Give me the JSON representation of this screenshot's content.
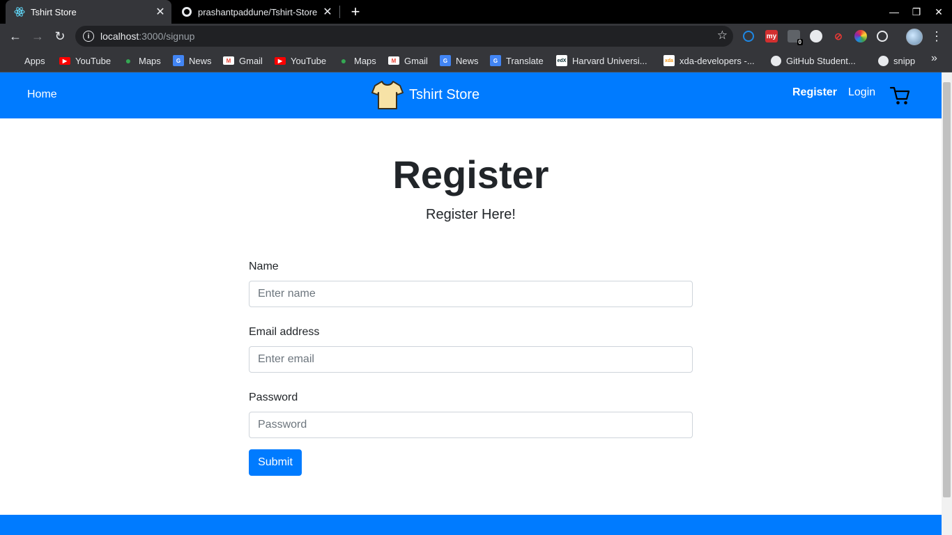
{
  "browser": {
    "tabs": [
      {
        "title": "Tshirt Store",
        "active": true,
        "icon": "react-icon"
      },
      {
        "title": "prashantpaddune/Tshirt-Store",
        "active": false,
        "icon": "github-icon"
      }
    ],
    "url_host": "localhost",
    "url_path": ":3000/signup",
    "bookmarks": [
      {
        "label": "Apps",
        "icon": "apps-grid-icon"
      },
      {
        "label": "YouTube",
        "icon": "youtube-icon"
      },
      {
        "label": "Maps",
        "icon": "maps-icon"
      },
      {
        "label": "News",
        "icon": "google-news-icon"
      },
      {
        "label": "Gmail",
        "icon": "gmail-icon"
      },
      {
        "label": "YouTube",
        "icon": "youtube-icon"
      },
      {
        "label": "Maps",
        "icon": "maps-icon"
      },
      {
        "label": "Gmail",
        "icon": "gmail-icon"
      },
      {
        "label": "News",
        "icon": "google-news-icon"
      },
      {
        "label": "Translate",
        "icon": "translate-icon"
      },
      {
        "label": "Harvard Universi...",
        "icon": "edx-icon"
      },
      {
        "label": "xda-developers -...",
        "icon": "xda-icon"
      },
      {
        "label": "GitHub Student...",
        "icon": "github-icon"
      },
      {
        "label": "snipp",
        "icon": "github-icon"
      }
    ],
    "extension_badge": "0"
  },
  "navbar": {
    "home": "Home",
    "brand": "Tshirt Store",
    "register": "Register",
    "login": "Login"
  },
  "page": {
    "title": "Register",
    "subtitle": "Register Here!"
  },
  "form": {
    "name_label": "Name",
    "name_placeholder": "Enter name",
    "email_label": "Email address",
    "email_placeholder": "Enter email",
    "password_label": "Password",
    "password_placeholder": "Password",
    "submit": "Submit"
  },
  "colors": {
    "primary": "#007bff",
    "text": "#212529",
    "chrome_dark": "#35363a"
  }
}
